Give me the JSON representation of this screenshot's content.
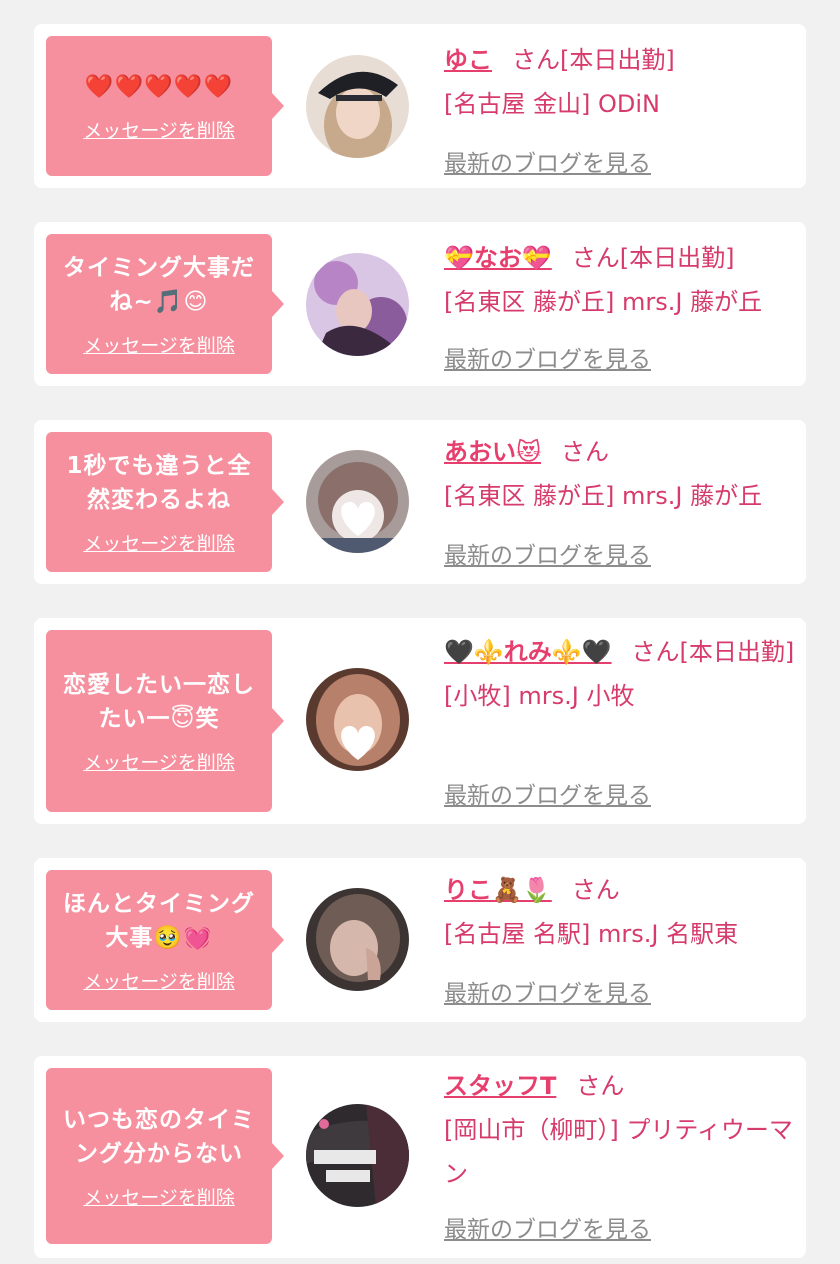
{
  "delete_label": "メッセージを削除",
  "blog_label": "最新のブログを見る",
  "san_suffix": "さん",
  "items": [
    {
      "message": "❤️❤️❤️❤️❤️",
      "name": "ゆこ",
      "status": "[本日出勤]",
      "location": "[名古屋 金山] ODiN",
      "avatar_color": "#c7a98c"
    },
    {
      "message": "タイミング大事だね~🎵😊",
      "name": "💝なお💝",
      "status": "[本日出勤]",
      "location": "[名東区 藤が丘] mrs.J 藤が丘",
      "avatar_color": "#b785c6"
    },
    {
      "message": "1秒でも違うと全然変わるよね",
      "name": "あおい😻",
      "status": "",
      "location": "[名東区 藤が丘] mrs.J 藤が丘",
      "avatar_color": "#a58b86"
    },
    {
      "message": "恋愛したい一恋したい一😇笑",
      "name": "🖤⚜️れみ⚜️🖤",
      "status": "[本日出勤]",
      "location": "[小牧] mrs.J 小牧",
      "avatar_color": "#b7806a"
    },
    {
      "message": "ほんとタイミング大事🥹💓",
      "name": "りこ🧸🌷",
      "status": "",
      "location": "[名古屋 名駅] mrs.J 名駅東",
      "avatar_color": "#6f5d55"
    },
    {
      "message": "いつも恋のタイミング分からない",
      "name": "スタッフT",
      "status": "",
      "location": "[岡山市（柳町）] プリティウーマン",
      "avatar_color": "#2e2a2d"
    }
  ]
}
